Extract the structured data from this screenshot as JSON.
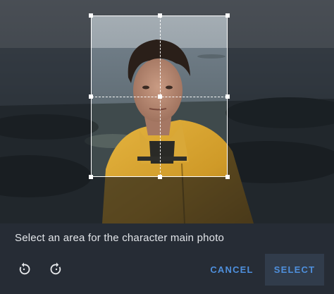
{
  "instruction": "Select an area for the character main photo",
  "toolbar": {
    "rotate_left_icon": "rotate-left-icon",
    "rotate_right_icon": "rotate-right-icon"
  },
  "actions": {
    "cancel_label": "CANCEL",
    "select_label": "SELECT"
  },
  "colors": {
    "accent": "#4e8fdc",
    "panel": "#262c35",
    "select_button_bg": "#313c4b"
  }
}
